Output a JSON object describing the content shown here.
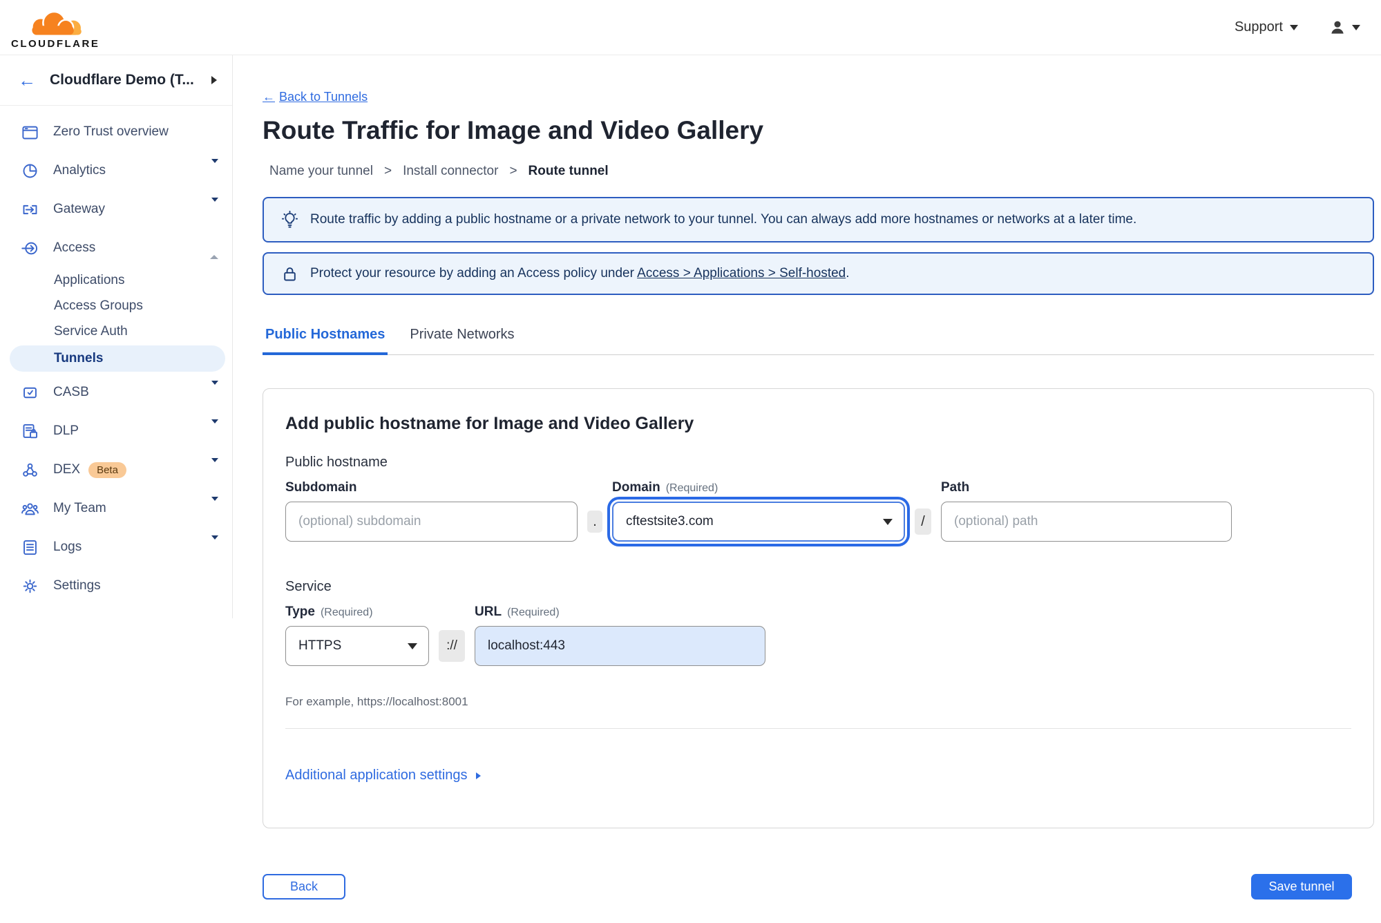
{
  "topbar": {
    "brand": "CLOUDFLARE",
    "support_label": "Support"
  },
  "icons": {
    "back_arrow": "←"
  },
  "sidebar": {
    "account_name": "Cloudflare Demo (T...",
    "items": [
      {
        "label": "Zero Trust overview"
      },
      {
        "label": "Analytics"
      },
      {
        "label": "Gateway"
      },
      {
        "label": "Access"
      },
      {
        "label": "CASB"
      },
      {
        "label": "DLP"
      },
      {
        "label": "DEX",
        "badge": "Beta"
      },
      {
        "label": "My Team"
      },
      {
        "label": "Logs"
      },
      {
        "label": "Settings"
      }
    ],
    "access_children": [
      {
        "label": "Applications"
      },
      {
        "label": "Access Groups"
      },
      {
        "label": "Service Auth"
      },
      {
        "label": "Tunnels",
        "active": true
      }
    ]
  },
  "page": {
    "back_link": "Back to Tunnels",
    "title": "Route Traffic for Image and Video Gallery",
    "step_separator": ">",
    "steps": [
      {
        "label": "Name your tunnel"
      },
      {
        "label": "Install connector"
      },
      {
        "label": "Route tunnel"
      }
    ],
    "banners": {
      "tip_text": "Route traffic by adding a public hostname or a private network to your tunnel. You can always add more hostnames or networks at a later time.",
      "access_prefix": "Protect your resource by adding an Access policy under",
      "access_link": "Access > Applications > Self-hosted",
      "access_suffix": "."
    },
    "tabs": [
      {
        "label": "Public Hostnames"
      },
      {
        "label": "Private Networks"
      }
    ]
  },
  "form": {
    "heading": "Add public hostname for Image and Video Gallery",
    "public_hostname_label": "Public hostname",
    "subdomain": {
      "label": "Subdomain",
      "placeholder": "(optional) subdomain"
    },
    "domain": {
      "label": "Domain",
      "required": "(Required)",
      "value": "cftestsite3.com"
    },
    "path": {
      "label": "Path",
      "placeholder": "(optional) path"
    },
    "dot_separator": ".",
    "slash_separator": "/",
    "service_label": "Service",
    "type": {
      "label": "Type",
      "required": "(Required)",
      "value": "HTTPS"
    },
    "scheme_separator": "://",
    "url": {
      "label": "URL",
      "required": "(Required)",
      "value": "localhost:443"
    },
    "example": "For example, https://localhost:8001",
    "additional_settings": "Additional application settings"
  },
  "footer": {
    "back_label": "Back",
    "save_label": "Save tunnel"
  },
  "colors": {
    "accent_blue": "#2f6be0",
    "active_tab_blue": "#2468d8",
    "save_button_blue": "#2b70ea",
    "banner_border": "#2d5dc0",
    "banner_bg": "#edf4fc",
    "banner_text": "#16325c",
    "active_nav_bg": "#e8f1fb",
    "nav_icon_blue": "#3a66cc",
    "beta_badge_bg": "#f9c996",
    "logo_orange": "#f6821f",
    "logo_light_orange": "#fbad41",
    "url_input_bg": "#dce9fc"
  }
}
